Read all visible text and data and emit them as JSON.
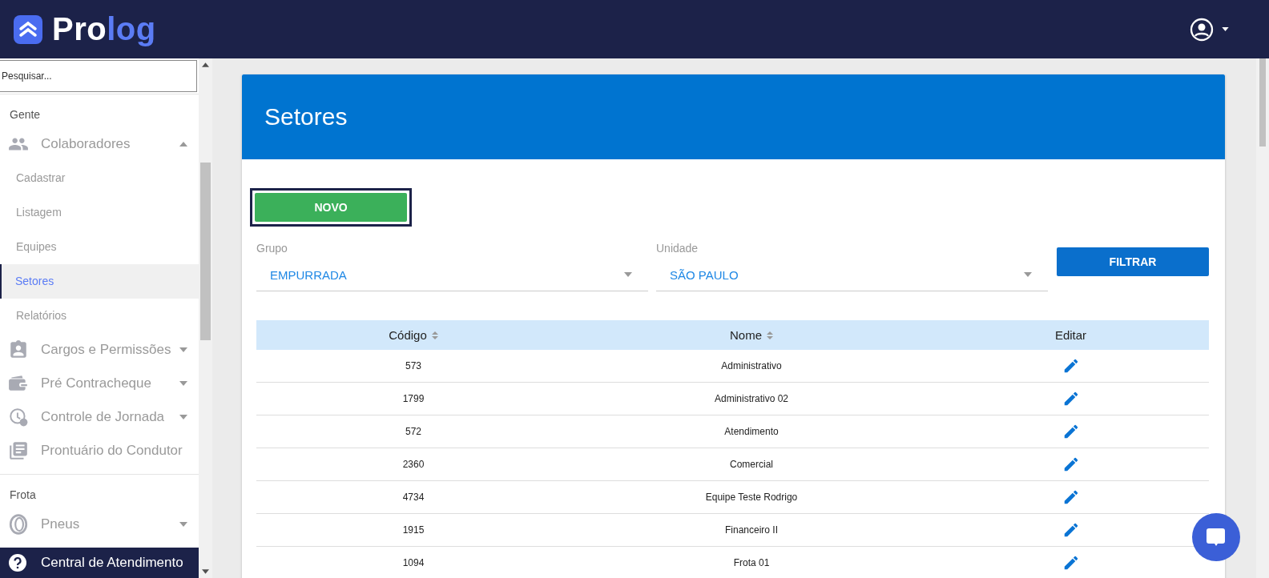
{
  "header": {
    "logo_text": "Pro",
    "logo_text_accent": "log"
  },
  "sidebar": {
    "search": {
      "placeholder": "Pesquisar..."
    },
    "sections": [
      {
        "title": "Gente",
        "items": [
          {
            "label": "Colaboradores",
            "expanded": true,
            "children": [
              {
                "label": "Cadastrar",
                "selected": false
              },
              {
                "label": "Listagem",
                "selected": false
              },
              {
                "label": "Equipes",
                "selected": false
              },
              {
                "label": "Setores",
                "selected": true
              },
              {
                "label": "Relatórios",
                "selected": false
              }
            ]
          },
          {
            "label": "Cargos e Permissões",
            "expanded": false
          },
          {
            "label": "Pré Contracheque",
            "expanded": false
          },
          {
            "label": "Controle de Jornada",
            "expanded": false
          },
          {
            "label": "Prontuário do Condutor"
          }
        ]
      },
      {
        "title": "Frota",
        "items": [
          {
            "label": "Pneus",
            "expanded": false
          }
        ]
      }
    ],
    "footer": "Central de Atendimento"
  },
  "page": {
    "title": "Setores",
    "new_button": {
      "label": "NOVO",
      "focused": true
    },
    "filters": [
      {
        "label": "Grupo",
        "value": "EMPURRADA"
      },
      {
        "label": "Unidade",
        "value": "SÃO PAULO"
      }
    ],
    "filter_button": "FILTRAR",
    "table": {
      "columns": [
        {
          "label": "Código",
          "sortable": true
        },
        {
          "label": "Nome",
          "sortable": true
        },
        {
          "label": "Editar",
          "sortable": false
        }
      ],
      "rows": [
        {
          "code": "573",
          "name": "Administrativo"
        },
        {
          "code": "1799",
          "name": "Administrativo 02"
        },
        {
          "code": "572",
          "name": "Atendimento"
        },
        {
          "code": "2360",
          "name": "Comercial"
        },
        {
          "code": "4734",
          "name": "Equipe Teste Rodrigo"
        },
        {
          "code": "1915",
          "name": "Financeiro II"
        },
        {
          "code": "1094",
          "name": "Frota 01"
        }
      ]
    }
  }
}
